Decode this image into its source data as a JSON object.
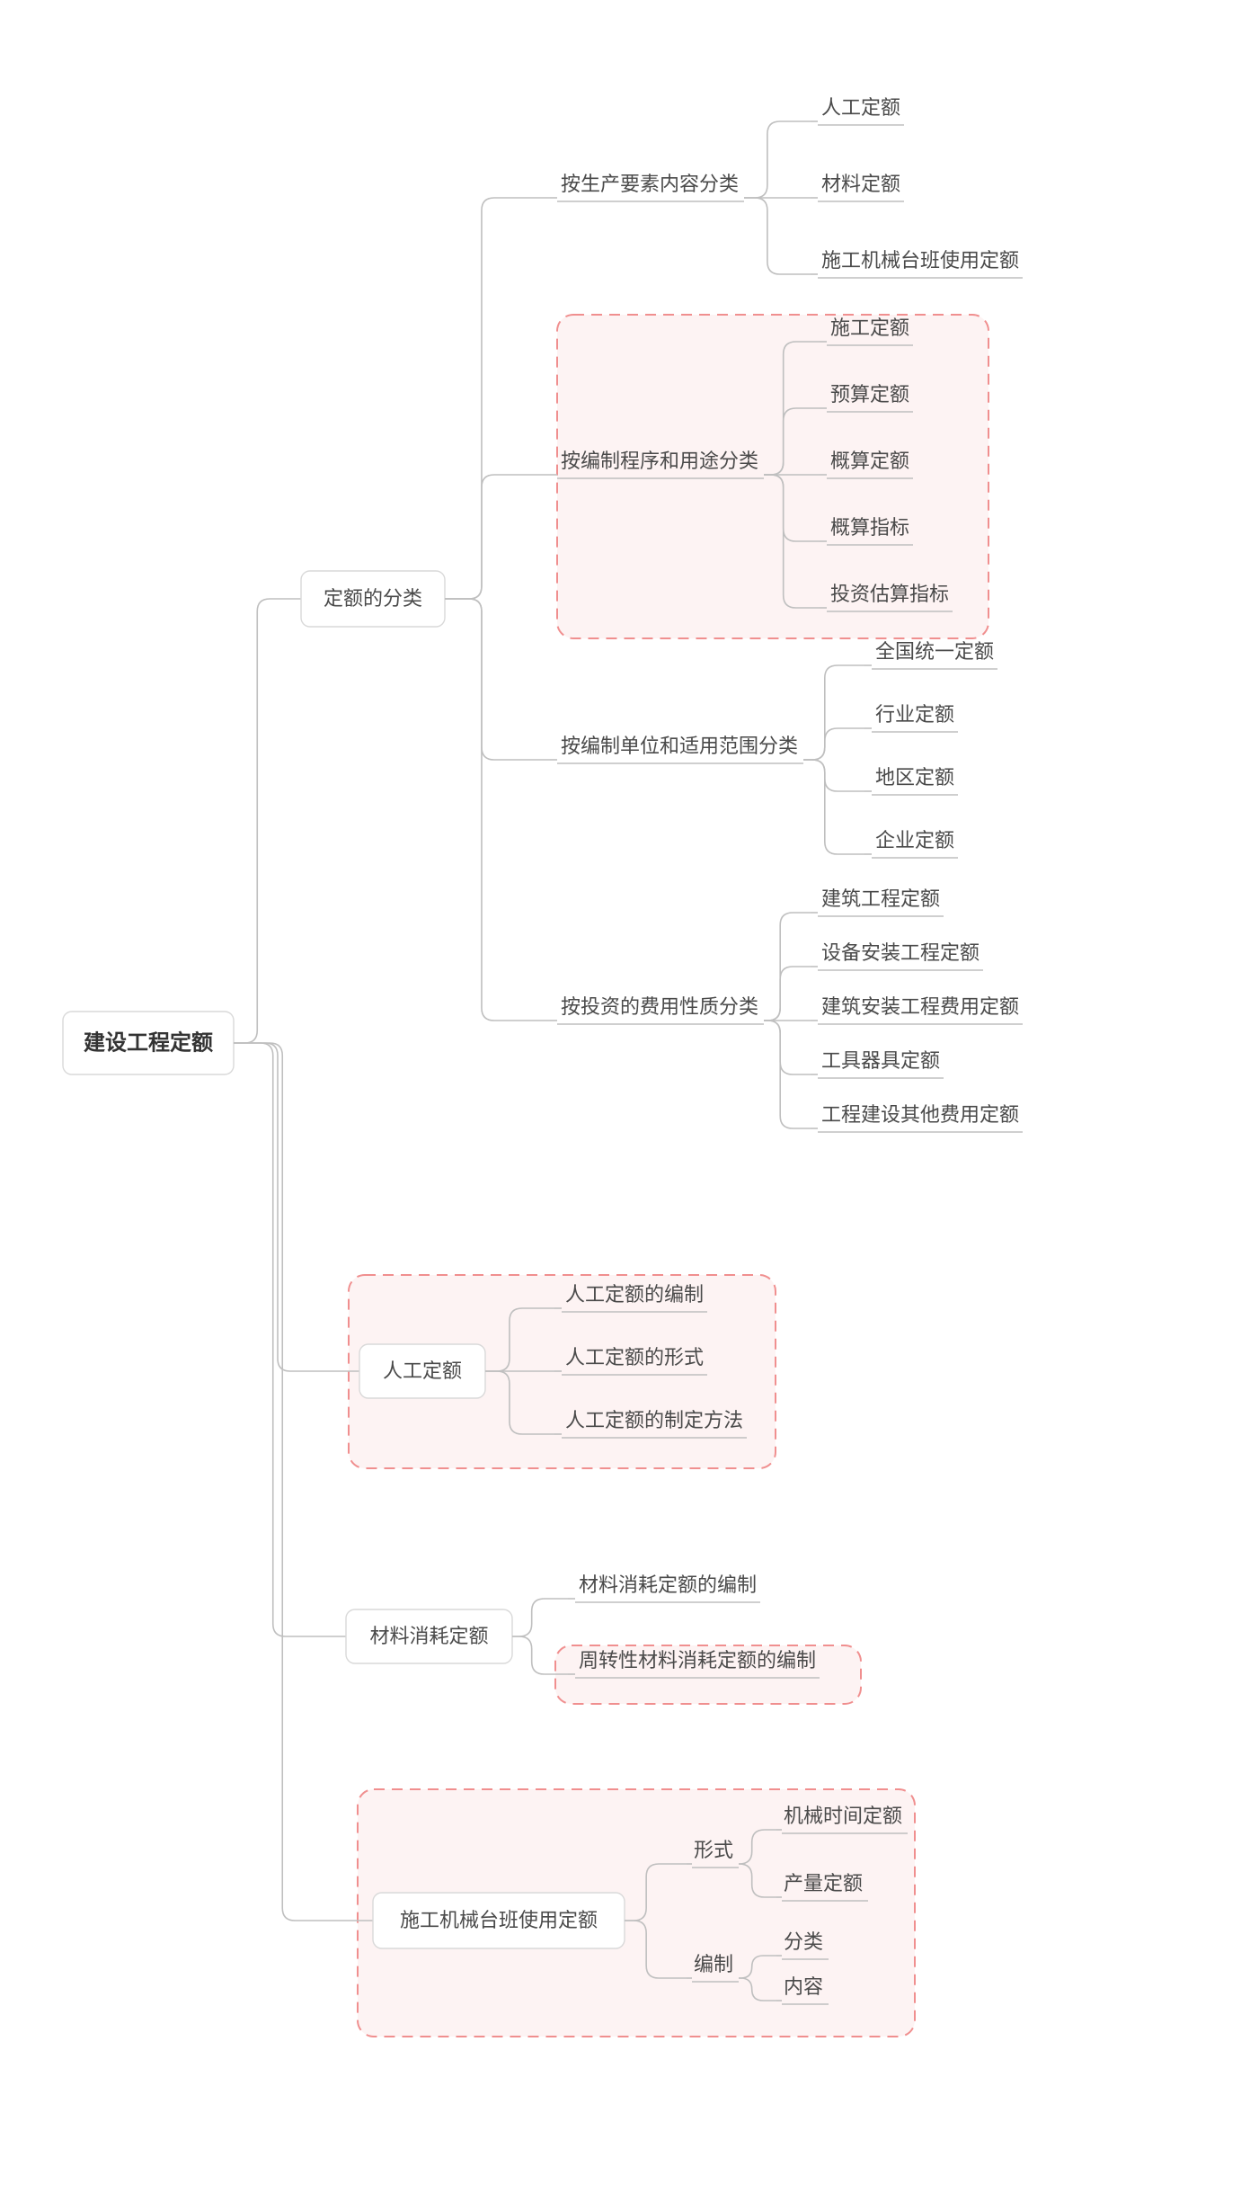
{
  "root": "建设工程定额",
  "b1": {
    "label": "定额的分类",
    "g1": {
      "label": "按生产要素内容分类",
      "items": [
        "人工定额",
        "材料定额",
        "施工机械台班使用定额"
      ]
    },
    "g2": {
      "label": "按编制程序和用途分类",
      "items": [
        "施工定额",
        "预算定额",
        "概算定额",
        "概算指标",
        "投资估算指标"
      ]
    },
    "g3": {
      "label": "按编制单位和适用范围分类",
      "items": [
        "全国统一定额",
        "行业定额",
        "地区定额",
        "企业定额"
      ]
    },
    "g4": {
      "label": "按投资的费用性质分类",
      "items": [
        "建筑工程定额",
        "设备安装工程定额",
        "建筑安装工程费用定额",
        "工具器具定额",
        "工程建设其他费用定额"
      ]
    }
  },
  "b2": {
    "label": "人工定额",
    "items": [
      "人工定额的编制",
      "人工定额的形式",
      "人工定额的制定方法"
    ]
  },
  "b3": {
    "label": "材料消耗定额",
    "items": [
      "材料消耗定额的编制",
      "周转性材料消耗定额的编制"
    ]
  },
  "b4": {
    "label": "施工机械台班使用定额",
    "g1": {
      "label": "形式",
      "items": [
        "机械时间定额",
        "产量定额"
      ]
    },
    "g2": {
      "label": "编制",
      "items": [
        "分类",
        "内容"
      ]
    }
  },
  "colors": {
    "highlight_fill": "#fdf3f3",
    "highlight_stroke": "#f08f8f"
  }
}
